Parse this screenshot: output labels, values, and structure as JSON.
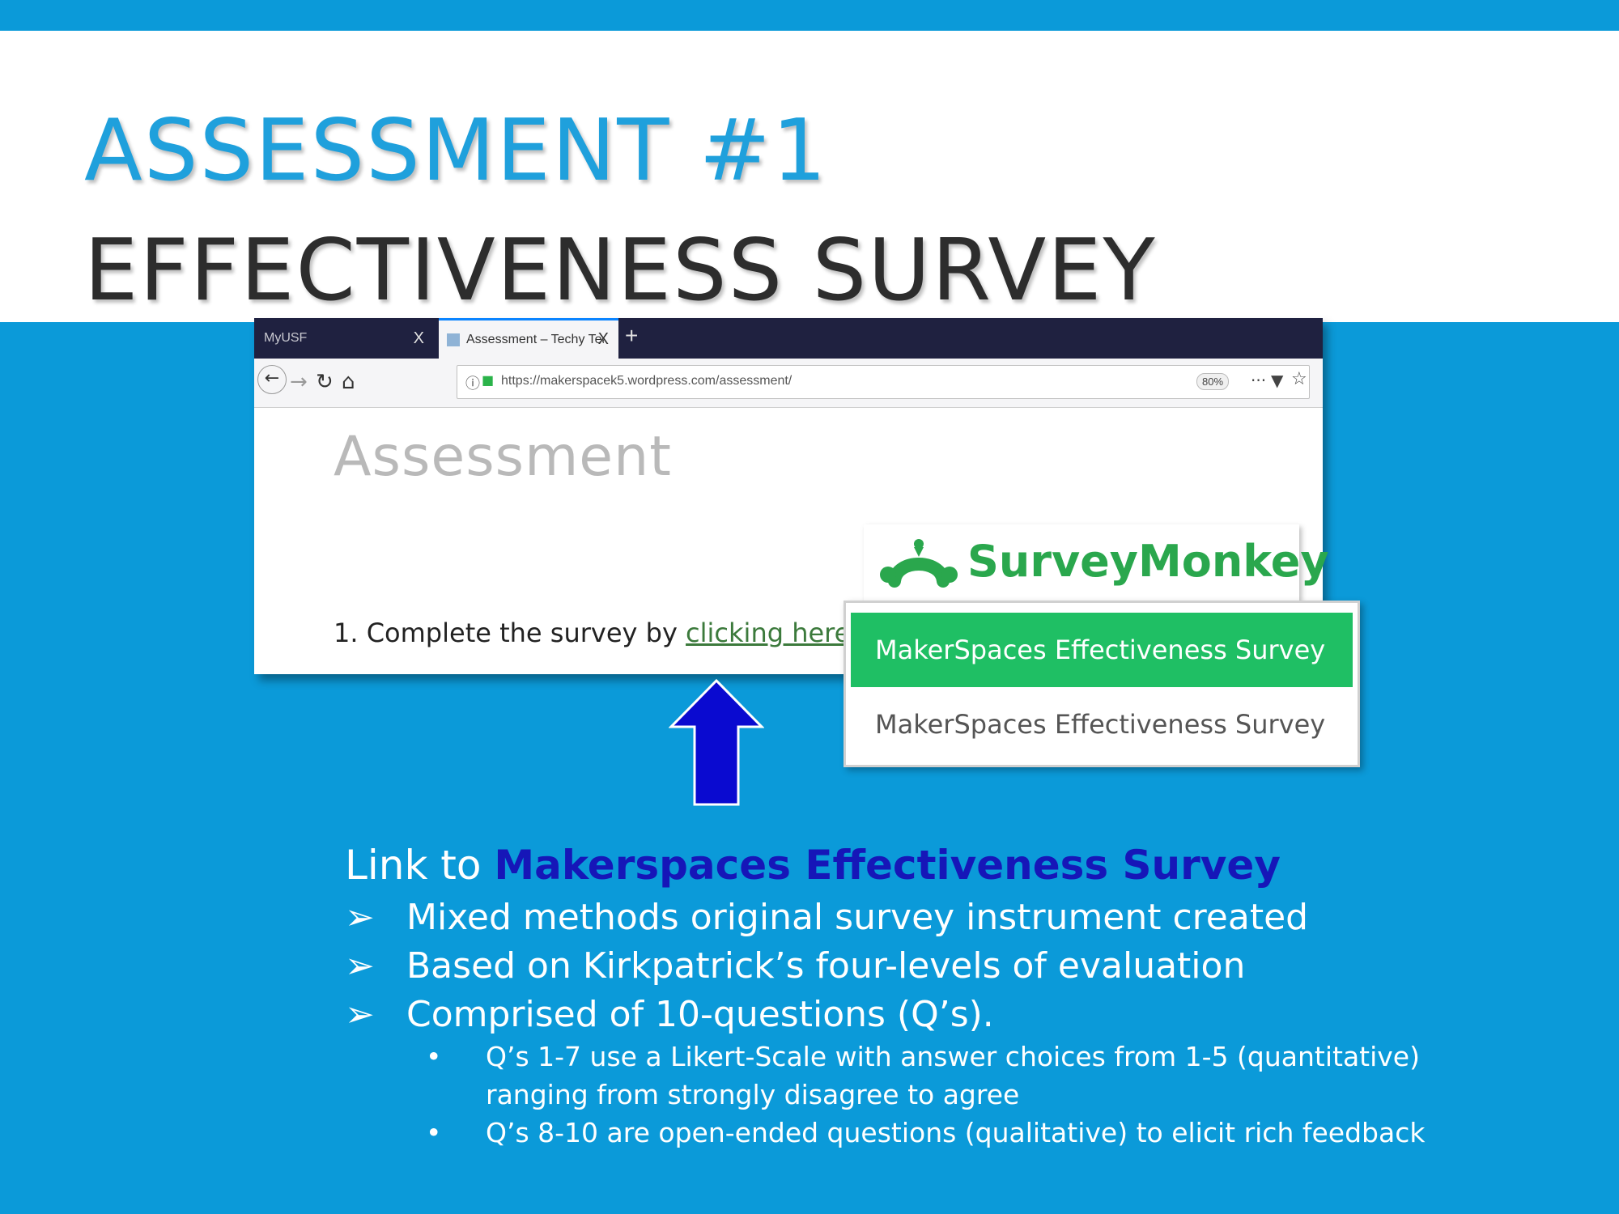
{
  "slide": {
    "title_line1": "ASSESSMENT #1",
    "title_line2": "EFFECTIVENESS SURVEY"
  },
  "browser": {
    "tabs": [
      {
        "label": "MyUSF",
        "close": "X"
      },
      {
        "label": "Assessment – Techy Teacher's",
        "close": "X"
      }
    ],
    "new_tab": "+",
    "url": "https://makerspacek5.wordpress.com/assessment/",
    "zoom": "80%",
    "page_heading": "Assessment",
    "instruction_prefix": "1. Complete the survey by ",
    "instruction_link": "clicking here",
    "instruction_suffix": "."
  },
  "surveymonkey": {
    "logo_text": "SurveyMonkey",
    "items": [
      {
        "label": "MakerSpaces Effectiveness Survey",
        "selected": true
      },
      {
        "label": "MakerSpaces Effectiveness Survey",
        "selected": false
      }
    ]
  },
  "body": {
    "link_prefix": "Link to ",
    "link_text": "Makerspaces Effectiveness Survey",
    "bullets": [
      "Mixed methods original survey instrument created",
      "Based on Kirkpatrick’s four-levels of evaluation",
      "Comprised of 10-questions (Q’s)."
    ],
    "sub_bullets": [
      "Q’s 1-7 use a Likert-Scale with answer choices from 1-5  (quantitative)",
      "ranging from strongly disagree to agree",
      "Q’s 8-10 are open-ended questions (qualitative) to elicit rich feedback"
    ]
  },
  "colors": {
    "background": "#0b9ad9",
    "title_blue": "#1fa0dc",
    "link_blue": "#1616b8",
    "sm_green": "#1fbf64",
    "arrow_blue": "#0a0ad0"
  }
}
